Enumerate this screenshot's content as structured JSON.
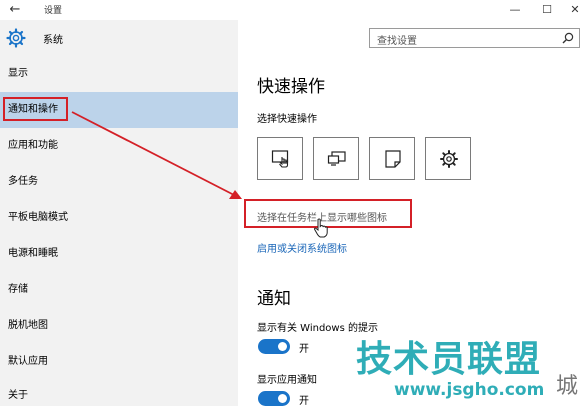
{
  "window": {
    "title": "设置",
    "back_glyph": "←",
    "min_glyph": "—",
    "max_glyph": "☐",
    "close_glyph": "✕"
  },
  "sidebar": {
    "header": "系统",
    "items": [
      {
        "label": "显示"
      },
      {
        "label": "通知和操作",
        "active": true
      },
      {
        "label": "应用和功能"
      },
      {
        "label": "多任务"
      },
      {
        "label": "平板电脑模式"
      },
      {
        "label": "电源和睡眠"
      },
      {
        "label": "存储"
      },
      {
        "label": "脱机地图"
      },
      {
        "label": "默认应用"
      },
      {
        "label": "关于"
      }
    ]
  },
  "search": {
    "placeholder": "查找设置"
  },
  "main": {
    "quick_actions_title": "快速操作",
    "choose_quick_actions": "选择快速操作",
    "taskbar_icons_link": "选择在任务栏上显示哪些图标",
    "system_icons_link": "启用或关闭系统图标",
    "notifications_title": "通知",
    "tips_label": "显示有关 Windows 的提示",
    "tips_state": "开",
    "app_notif_label": "显示应用通知",
    "app_notif_state": "开",
    "tiles": [
      {
        "icon": "tablet-mode-icon"
      },
      {
        "icon": "connect-icon"
      },
      {
        "icon": "note-icon"
      },
      {
        "icon": "all-settings-icon"
      }
    ]
  },
  "watermark": {
    "text": "技术员联盟",
    "url": "www.jsgho.com",
    "small": "城"
  },
  "colors": {
    "accent": "#1a74c9",
    "highlight": "#bcd3ea",
    "annotation_red": "#d42027"
  }
}
